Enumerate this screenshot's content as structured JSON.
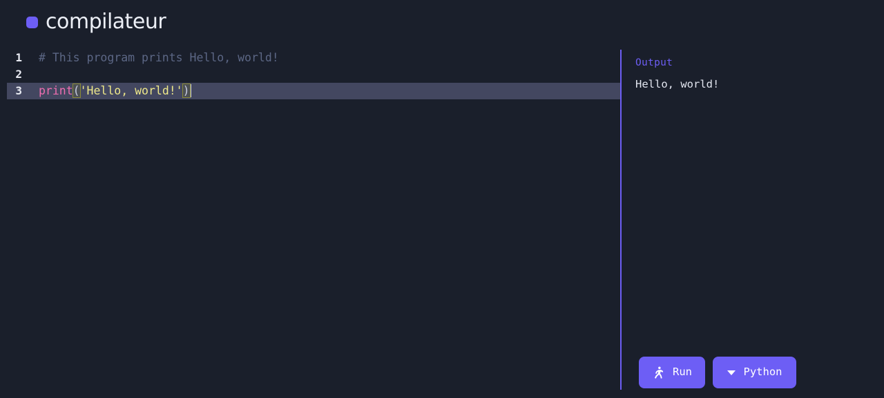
{
  "app": {
    "name": "compilateur",
    "logo_color": "#6d5ef5",
    "background_color": "#1a1f2b"
  },
  "editor": {
    "active_line": 3,
    "active_line_color": "#434760",
    "lines": [
      {
        "number": "1",
        "text": "# This program prints Hello, world!",
        "type": "comment"
      },
      {
        "number": "2",
        "text": "",
        "type": "blank"
      },
      {
        "number": "3",
        "text": "print('Hello, world!')",
        "type": "code"
      }
    ],
    "line_numbers": {
      "l1": "1",
      "l2": "2",
      "l3": "3"
    },
    "line1_comment": "# This program prints Hello, world!",
    "line3_tokens": {
      "fn": "print",
      "open_paren": "(",
      "string": "'Hello, world!'",
      "close_paren": ")"
    },
    "syntax_colors": {
      "comment": "#5c6785",
      "function": "#ef6eb0",
      "string": "#eee88a",
      "paren_match_border": "#8a8a35"
    }
  },
  "output": {
    "label": "Output",
    "label_color": "#6d5ef5",
    "content": "Hello, world!",
    "divider_color": "#6d5ef5"
  },
  "toolbar": {
    "run_label": "Run",
    "run_icon": "running-person-icon",
    "language_label": "Python",
    "language_icon": "chevron-down-icon",
    "button_color": "#6d5ef5"
  }
}
